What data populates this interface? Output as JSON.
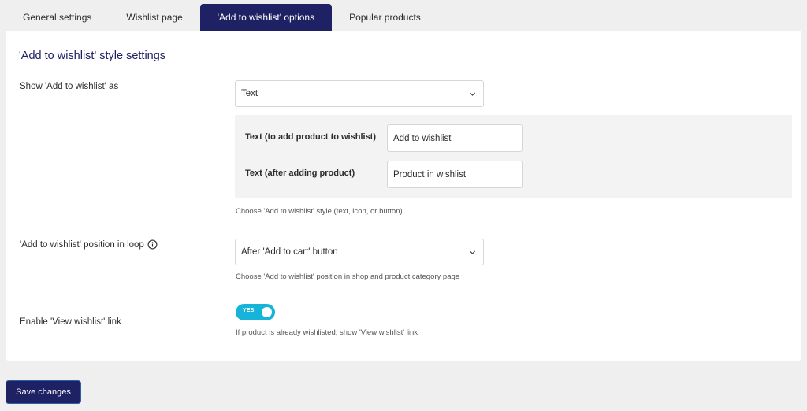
{
  "tabs": [
    {
      "label": "General settings",
      "active": false
    },
    {
      "label": "Wishlist page",
      "active": false
    },
    {
      "label": "'Add to wishlist' options",
      "active": true
    },
    {
      "label": "Popular products",
      "active": false
    }
  ],
  "section": {
    "title": "'Add to wishlist' style settings"
  },
  "fields": {
    "show_as": {
      "label": "Show 'Add to wishlist' as",
      "selected": "Text",
      "help": "Choose 'Add to wishlist' style (text, icon, or button).",
      "sub": {
        "add_text": {
          "label": "Text (to add product to wishlist)",
          "value": "Add to wishlist"
        },
        "after_text": {
          "label": "Text (after adding product)",
          "value": "Product in wishlist"
        }
      }
    },
    "position": {
      "label": "'Add to wishlist' position in loop",
      "info_icon": "info-icon",
      "selected": "After 'Add to cart' button",
      "help": "Choose 'Add to wishlist' position in shop and product category page"
    },
    "view_link": {
      "label": "Enable 'View wishlist' link",
      "toggle_label": "YES",
      "enabled": true,
      "help": "If product is already wishlisted, show 'View wishlist' link"
    }
  },
  "footer": {
    "save_label": "Save changes"
  },
  "colors": {
    "accent": "#1e2264",
    "toggle_on": "#16b4d8",
    "background": "#efefef"
  }
}
